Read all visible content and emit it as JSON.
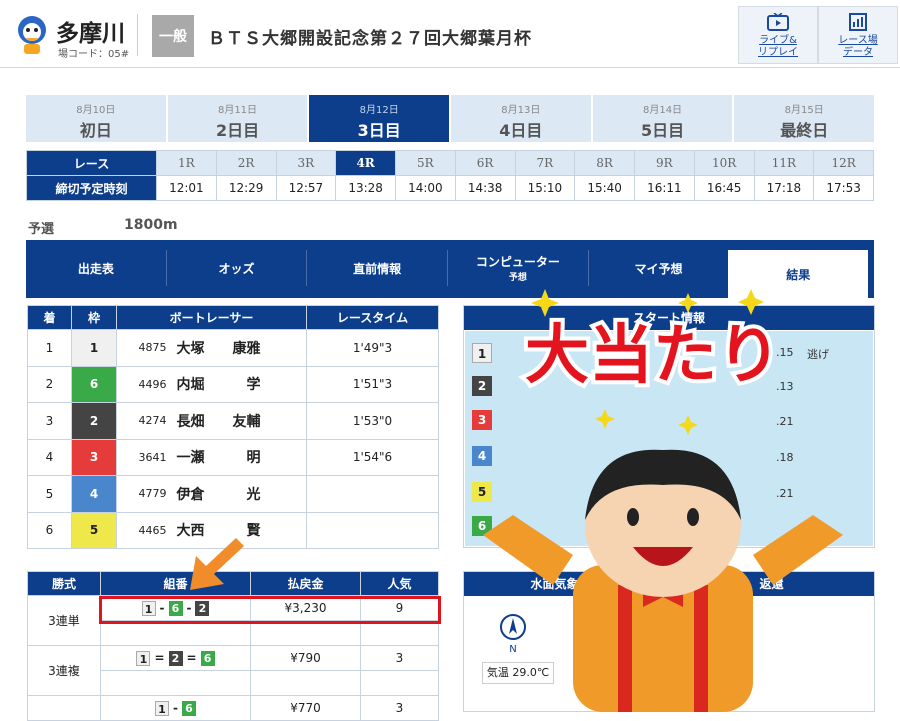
{
  "header": {
    "venue": "多摩川",
    "code": "場コード：05#",
    "grade": "一般",
    "title": "ＢＴＳ大郷開設記念第２７回大郷葉月杯",
    "btn_live": [
      "ライブ&",
      "リプレイ"
    ],
    "btn_data": [
      "レース場",
      "データ"
    ]
  },
  "days": [
    {
      "date": "8月10日",
      "name": "初日"
    },
    {
      "date": "8月11日",
      "name": "2日目"
    },
    {
      "date": "8月12日",
      "name": "3日目"
    },
    {
      "date": "8月13日",
      "name": "4日目"
    },
    {
      "date": "8月14日",
      "name": "5日目"
    },
    {
      "date": "8月15日",
      "name": "最終日"
    }
  ],
  "races": {
    "label_race": "レース",
    "label_time": "締切予定時刻",
    "list": [
      {
        "r": "1R",
        "t": "12:01"
      },
      {
        "r": "2R",
        "t": "12:29"
      },
      {
        "r": "3R",
        "t": "12:57"
      },
      {
        "r": "4R",
        "t": "13:28"
      },
      {
        "r": "5R",
        "t": "14:00"
      },
      {
        "r": "6R",
        "t": "14:38"
      },
      {
        "r": "7R",
        "t": "15:10"
      },
      {
        "r": "8R",
        "t": "15:40"
      },
      {
        "r": "9R",
        "t": "16:11"
      },
      {
        "r": "10R",
        "t": "16:45"
      },
      {
        "r": "11R",
        "t": "17:18"
      },
      {
        "r": "12R",
        "t": "17:53"
      }
    ]
  },
  "race_info": {
    "grade": "予選",
    "distance": "1800m"
  },
  "tabs": [
    {
      "label": "出走表",
      "sub": ""
    },
    {
      "label": "オッズ",
      "sub": ""
    },
    {
      "label": "直前情報",
      "sub": ""
    },
    {
      "label": "コンピューター",
      "sub": "予想"
    },
    {
      "label": "マイ予想",
      "sub": ""
    },
    {
      "label": "結果",
      "sub": ""
    }
  ],
  "result": {
    "headers": [
      "着",
      "枠",
      "ボートレーサー",
      "レースタイム"
    ],
    "rows": [
      {
        "pos": "1",
        "boat": "1",
        "reg": "4875",
        "name": "大塚　　康雅",
        "time": "1'49\"3"
      },
      {
        "pos": "2",
        "boat": "6",
        "reg": "4496",
        "name": "内堀　　　学",
        "time": "1'51\"3"
      },
      {
        "pos": "3",
        "boat": "2",
        "reg": "4274",
        "name": "長畑　　友輔",
        "time": "1'53\"0"
      },
      {
        "pos": "4",
        "boat": "3",
        "reg": "3641",
        "name": "一瀬　　　明",
        "time": "1'54\"6"
      },
      {
        "pos": "5",
        "boat": "4",
        "reg": "4779",
        "name": "伊倉　　　光",
        "time": ""
      },
      {
        "pos": "6",
        "boat": "5",
        "reg": "4465",
        "name": "大西　　　賢",
        "time": ""
      }
    ]
  },
  "payout": {
    "headers": [
      "勝式",
      "組番",
      "払戻金",
      "人気"
    ],
    "trifecta": {
      "label": "3連単",
      "combo": [
        "1",
        "6",
        "2"
      ],
      "amount": "¥3,230",
      "pop": "9"
    },
    "trio": {
      "label": "3連複",
      "combo": [
        "1",
        "2",
        "6"
      ],
      "amount": "¥790",
      "pop": "3"
    },
    "exacta": {
      "combo": [
        "1",
        "6"
      ],
      "amount": "¥770",
      "pop": "3"
    }
  },
  "start": {
    "title": "スタート情報",
    "rows": [
      {
        "boat": "1",
        "st": ".15",
        "note": "逃げ"
      },
      {
        "boat": "2",
        "st": ".13",
        "note": ""
      },
      {
        "boat": "3",
        "st": ".21",
        "note": ""
      },
      {
        "boat": "4",
        "st": ".18",
        "note": ""
      },
      {
        "boat": "5",
        "st": ".21",
        "note": ""
      },
      {
        "boat": "6",
        "st": "",
        "note": ""
      }
    ]
  },
  "weather": {
    "title_left": "水面気象情報",
    "title_right": "返還",
    "compass_n": "N",
    "temp": "気温 29.0℃"
  },
  "overlay": {
    "text": "大当たり"
  },
  "colors": {
    "navy": "#0d3e8c",
    "highlight": "#e0141c",
    "arrow": "#f08c2a"
  }
}
